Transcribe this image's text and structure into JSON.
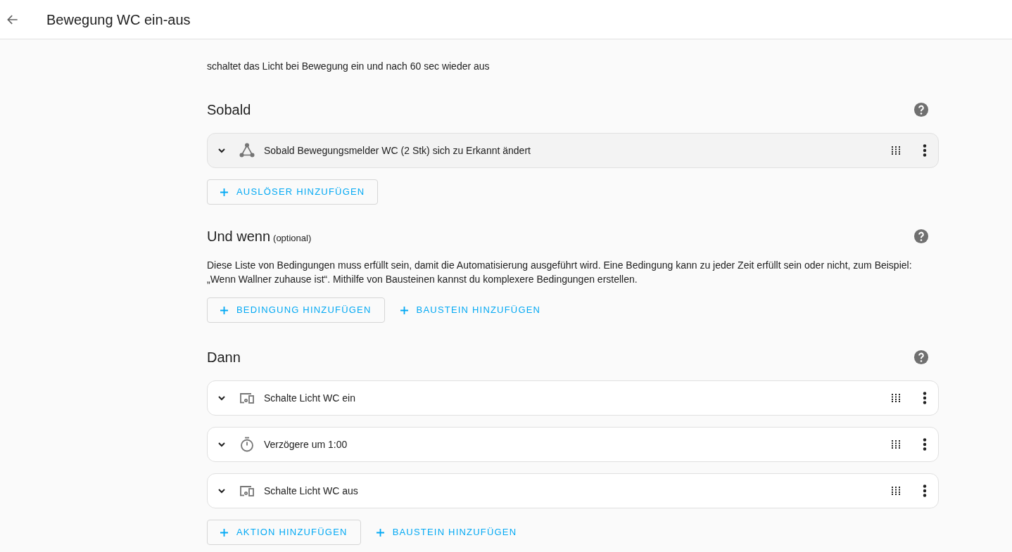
{
  "header": {
    "title": "Bewegung WC ein-aus"
  },
  "description": "schaltet das Licht bei Bewegung ein und nach 60 sec wieder aus",
  "sections": [
    {
      "title": "Sobald",
      "items": [
        {
          "kind": "trigger",
          "label": "Sobald Bewegungsmelder WC (2 Stk) sich zu Erkannt ändert"
        }
      ],
      "buttons": [
        {
          "kind": "outlined",
          "label": "AUSLÖSER HINZUFÜGEN"
        }
      ]
    },
    {
      "title": "Und wenn",
      "subtitle": "(optional)",
      "text": "Diese Liste von Bedingungen muss erfüllt sein, damit die Automatisierung ausgeführt wird. Eine Bedingung kann zu jeder Zeit erfüllt sein oder nicht, zum Beispiel: „Wenn Wallner zuhause ist“. Mithilfe von Bausteinen kannst du komplexere Bedingungen erstellen.",
      "buttons": [
        {
          "kind": "outlined",
          "label": "BEDINGUNG HINZUFÜGEN"
        },
        {
          "kind": "text",
          "label": "BAUSTEIN HINZUFÜGEN"
        }
      ]
    },
    {
      "title": "Dann",
      "items": [
        {
          "kind": "device",
          "label": "Schalte Licht WC ein"
        },
        {
          "kind": "delay",
          "label": "Verzögere um 1:00"
        },
        {
          "kind": "device",
          "label": "Schalte Licht WC aus"
        }
      ],
      "buttons": [
        {
          "kind": "outlined",
          "label": "AKTION HINZUFÜGEN"
        },
        {
          "kind": "text",
          "label": "BAUSTEIN HINZUFÜGEN"
        }
      ]
    }
  ]
}
